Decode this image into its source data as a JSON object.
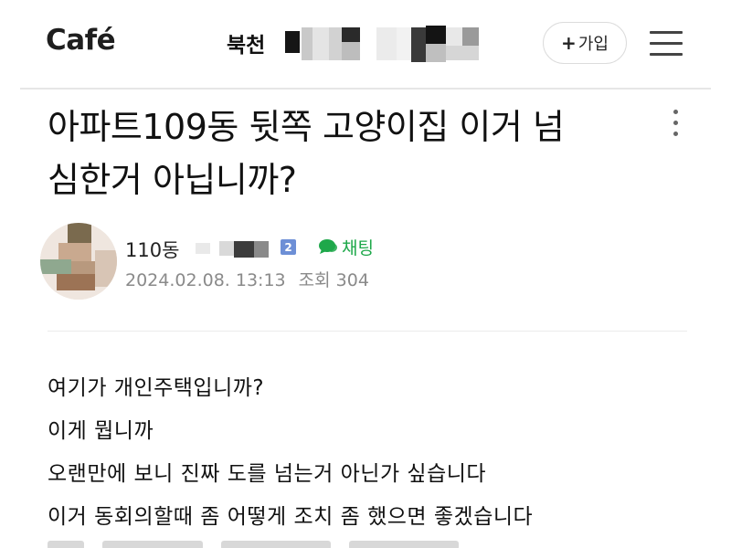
{
  "header": {
    "logo": "Café",
    "cafe_name_visible": "북천",
    "join_label": "가입",
    "join_plus": "+"
  },
  "post": {
    "title_line1": "아파트109동 뒷쪽 고양이집 이거 넘",
    "title_line2": "심한거 아닙니까?",
    "author_visible": "110동",
    "level_badge": "2",
    "chat_label": "채팅",
    "datetime": "2024.02.08. 13:13",
    "views_label": "조회 304",
    "body": [
      "여기가 개인주택입니까?",
      "이게 뭡니까",
      "오랜만에 보니 진짜 도를 넘는거 아닌가 싶습니다",
      "이거 동회의할때 좀 어떻게 조치 좀 했으면 좋겠습니다"
    ]
  },
  "colors": {
    "accent_green": "#1ea84a",
    "badge_blue": "#6d8fd6",
    "meta_gray": "#8a8a8a"
  },
  "icons": [
    "more-vertical-icon",
    "hamburger-menu-icon",
    "chat-bubble-icon"
  ]
}
